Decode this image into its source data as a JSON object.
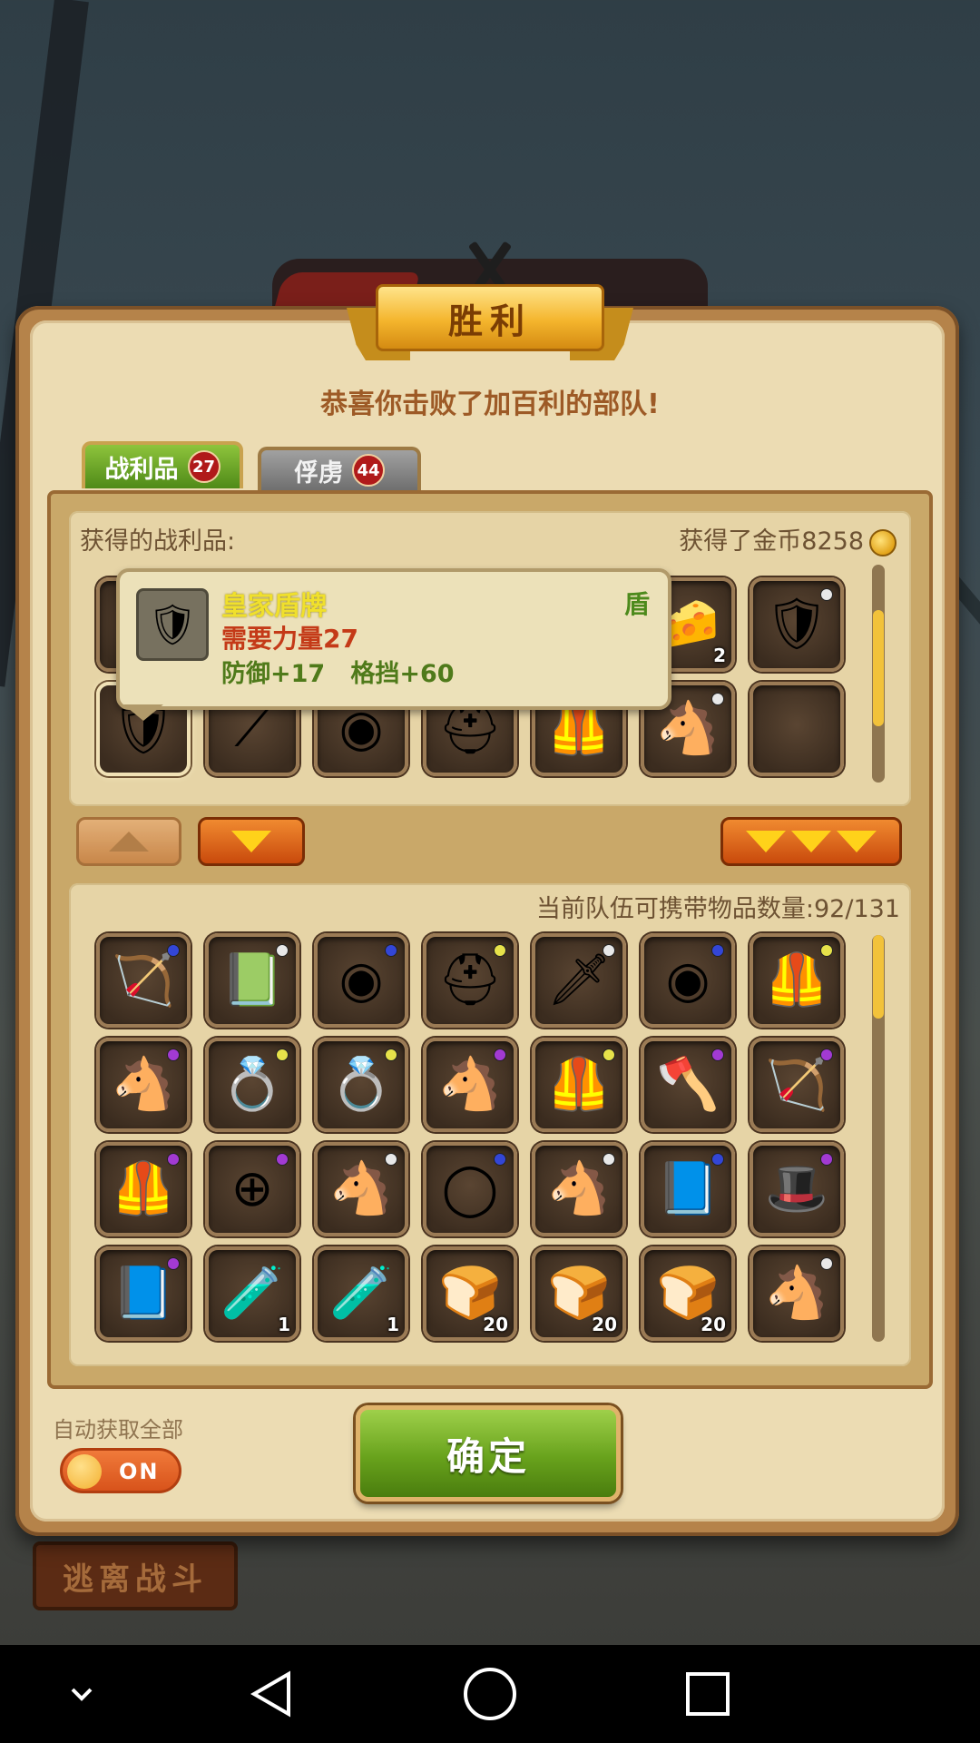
{
  "header": {
    "title": "胜利",
    "subtitle": "恭喜你击败了加百利的部队!"
  },
  "tabs": [
    {
      "label": "战利品",
      "count": "27",
      "active": true
    },
    {
      "label": "俘虏",
      "count": "44",
      "active": false
    }
  ],
  "loot": {
    "heading": "获得的战利品:",
    "gold_text": "获得了金币8258",
    "scroll_position": 0.45,
    "row1": [
      {
        "icon": "hidden-icon",
        "glyph": ""
      },
      {
        "icon": "hidden-icon",
        "glyph": ""
      },
      {
        "icon": "hidden-icon",
        "glyph": ""
      },
      {
        "icon": "hidden-icon",
        "glyph": ""
      },
      {
        "icon": "hidden-icon",
        "glyph": ""
      },
      {
        "icon": "cheese-icon",
        "glyph": "🧀",
        "qty": "2"
      },
      {
        "icon": "shield-icon",
        "glyph": "🛡",
        "dot": "white"
      }
    ],
    "row2": [
      {
        "icon": "royal-shield-icon",
        "glyph": "🛡",
        "selected": true
      },
      {
        "icon": "spear-icon",
        "glyph": "⟋"
      },
      {
        "icon": "round-shield-icon",
        "glyph": "◉"
      },
      {
        "icon": "hood-icon",
        "glyph": "⛑"
      },
      {
        "icon": "armor-icon",
        "glyph": "🦺"
      },
      {
        "icon": "horse-icon",
        "glyph": "🐴",
        "dot": "white"
      },
      {
        "icon": "empty-slot",
        "glyph": ""
      }
    ]
  },
  "tooltip": {
    "name": "皇家盾牌",
    "type": "盾",
    "requirement": "需要力量27",
    "stats": "防御+17   格挡+60"
  },
  "inventory": {
    "capacity_text": "当前队伍可携带物品数量:92/131",
    "scroll_position": 0.0,
    "rows": [
      [
        {
          "icon": "bow-icon",
          "glyph": "🏹",
          "dot": "blue"
        },
        {
          "icon": "book-icon",
          "glyph": "📗",
          "dot": "white"
        },
        {
          "icon": "round-shield-icon",
          "glyph": "◉",
          "dot": "blue"
        },
        {
          "icon": "helmet-icon",
          "glyph": "⛑",
          "dot": "yellow"
        },
        {
          "icon": "sword-icon",
          "glyph": "🗡",
          "dot": "white"
        },
        {
          "icon": "round-shield-icon",
          "glyph": "◉",
          "dot": "blue"
        },
        {
          "icon": "armor-icon",
          "glyph": "🦺",
          "dot": "yellow"
        }
      ],
      [
        {
          "icon": "horse-icon",
          "glyph": "🐴",
          "dot": "purple"
        },
        {
          "icon": "ring-icon",
          "glyph": "💍",
          "dot": "yellow"
        },
        {
          "icon": "ring-icon",
          "glyph": "💍",
          "dot": "yellow"
        },
        {
          "icon": "horse-icon",
          "glyph": "🐴",
          "dot": "purple"
        },
        {
          "icon": "armor-icon",
          "glyph": "🦺",
          "dot": "yellow"
        },
        {
          "icon": "axe-icon",
          "glyph": "🪓",
          "dot": "purple"
        },
        {
          "icon": "bow-icon",
          "glyph": "🏹",
          "dot": "purple"
        }
      ],
      [
        {
          "icon": "armor-icon",
          "glyph": "🦺",
          "dot": "purple"
        },
        {
          "icon": "cross-shield-icon",
          "glyph": "⊕",
          "dot": "purple"
        },
        {
          "icon": "horse-icon",
          "glyph": "🐴",
          "dot": "white"
        },
        {
          "icon": "ring-icon",
          "glyph": "◯",
          "dot": "blue"
        },
        {
          "icon": "horse-icon",
          "glyph": "🐴",
          "dot": "white"
        },
        {
          "icon": "book-icon",
          "glyph": "📘",
          "dot": "blue"
        },
        {
          "icon": "hat-armor-icon",
          "glyph": "🎩",
          "dot": "purple"
        }
      ],
      [
        {
          "icon": "book-icon",
          "glyph": "📘",
          "dot": "purple"
        },
        {
          "icon": "potion-icon",
          "glyph": "🧪",
          "qty": "1"
        },
        {
          "icon": "potion-icon",
          "glyph": "🧪",
          "qty": "1"
        },
        {
          "icon": "bread-icon",
          "glyph": "🍞",
          "qty": "20"
        },
        {
          "icon": "bread-icon",
          "glyph": "🍞",
          "qty": "20"
        },
        {
          "icon": "bread-icon",
          "glyph": "🍞",
          "qty": "20"
        },
        {
          "icon": "horse-icon",
          "glyph": "🐴",
          "dot": "white"
        }
      ]
    ]
  },
  "auto_collect": {
    "label": "自动获取全部",
    "state": "ON"
  },
  "buttons": {
    "confirm": "确定",
    "flee": "逃离战斗"
  },
  "colors": {
    "accent_green": "#68a21c",
    "gold": "#f4b52d",
    "tooltip_name": "#f0e02c",
    "requirement_red": "#c43a18"
  },
  "navbar": {
    "icons": [
      "chevron-down-icon",
      "back-icon",
      "home-icon",
      "recents-icon"
    ]
  }
}
